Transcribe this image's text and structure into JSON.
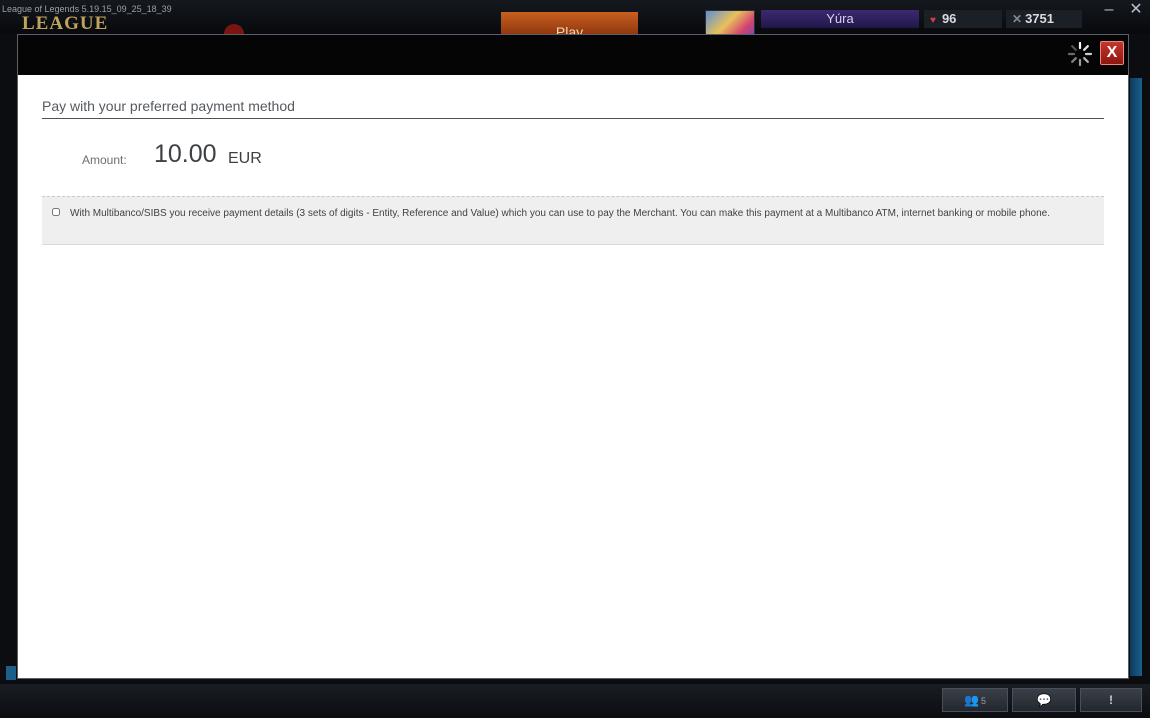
{
  "client": {
    "version": "League of Legends 5.19.15_09_25_18_39",
    "logo": "LEAGUE",
    "play_label": "Play",
    "summoner_name": "Yúra",
    "rp": "96",
    "ip": "3751",
    "window_minimize": "–",
    "window_close": "✕",
    "bottom_bar": {
      "friends_count": "5",
      "alert_label": "!"
    }
  },
  "modal": {
    "close_label": "X",
    "section_title": "Pay with your preferred payment method",
    "amount_label": "Amount:",
    "amount_value": "10.00",
    "amount_currency": "EUR",
    "payment_methods": [
      {
        "description": "With Multibanco/SIBS you receive payment details (3 sets of digits - Entity, Reference and Value) which you can use to pay the Merchant. You can make this payment at a Multibanco ATM, internet banking or mobile phone.",
        "checked": false
      }
    ]
  },
  "colors": {
    "close_button": "#b5261e",
    "modal_header": "#050506",
    "method_row_bg": "#efefef",
    "summoner_bg": "#2e2060",
    "play_button": "#b24c18"
  },
  "icons": {
    "spinner": "loading-spinner-icon",
    "rp": "heart-icon",
    "ip": "ip-icon",
    "friends": "friends-icon",
    "chat": "chat-icon"
  }
}
